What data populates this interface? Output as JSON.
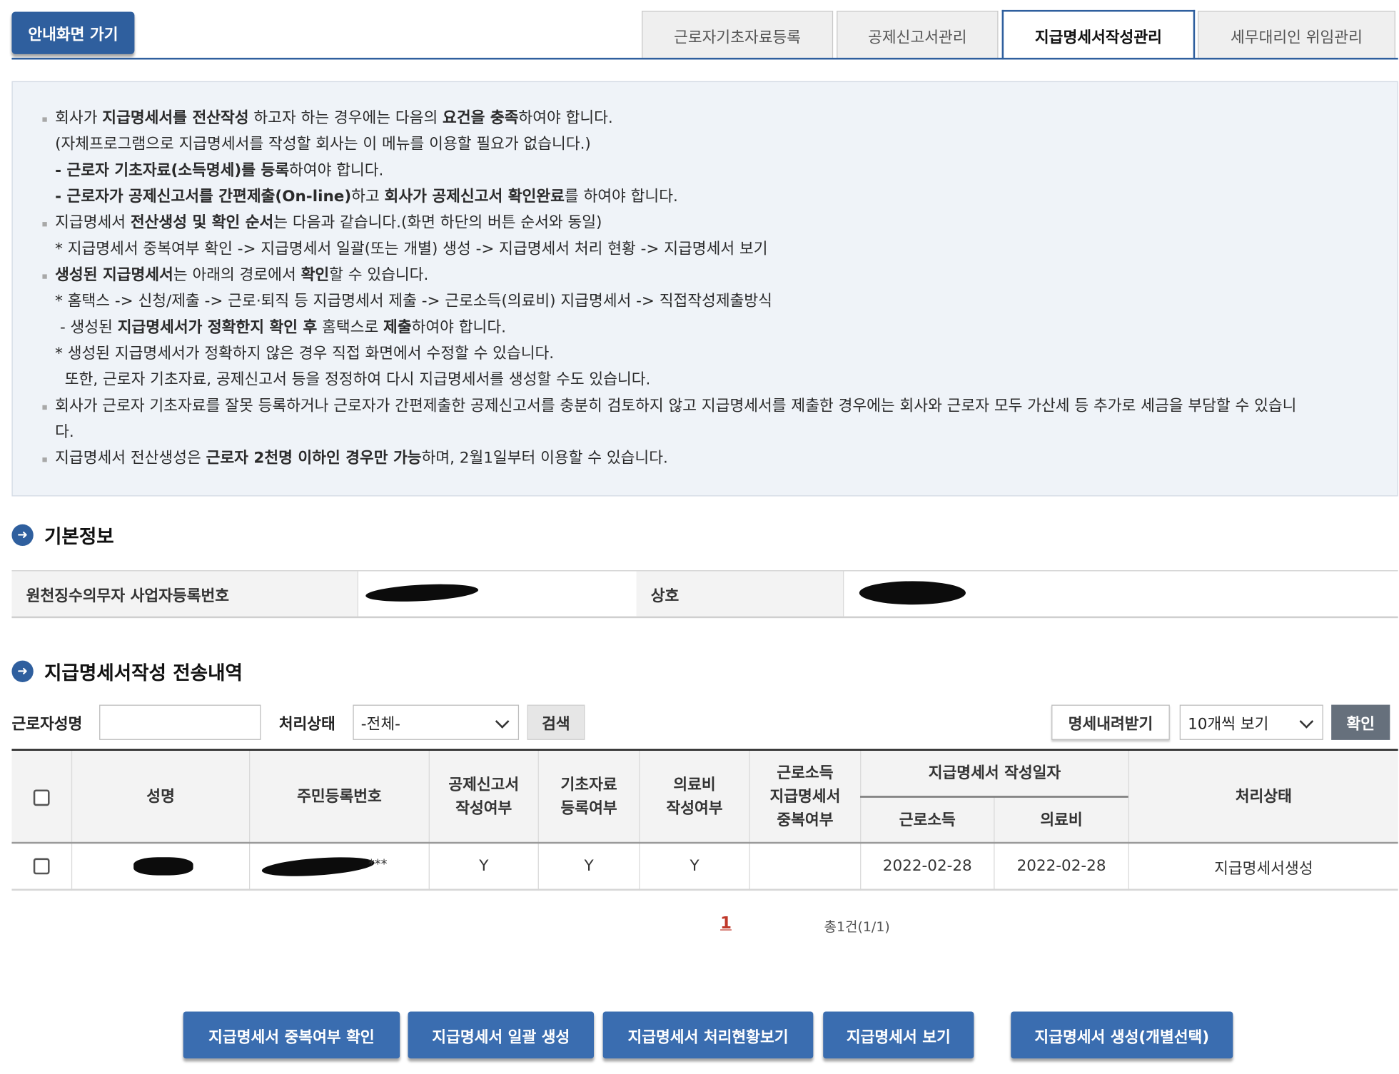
{
  "top": {
    "home_button": "안내화면 가기",
    "tabs": [
      "근로자기초자료등록",
      "공제신고서관리",
      "지급명세서작성관리",
      "세무대리인 위임관리"
    ],
    "active_tab": "지급명세서작성관리"
  },
  "notice": {
    "lines": [
      {
        "bullet": true,
        "segments": [
          [
            "회사가 ",
            false
          ],
          [
            "지급명세서를 전산작성",
            true
          ],
          [
            " 하고자 하는 경우에는 다음의 ",
            false
          ],
          [
            "요건을 충족",
            true
          ],
          [
            "하여야 합니다.",
            false
          ]
        ]
      },
      {
        "bullet": false,
        "segments": [
          [
            "(자체프로그램으로 지급명세서를 작성할 회사는 이 메뉴를 이용할 필요가 없습니다.)",
            false
          ]
        ]
      },
      {
        "bullet": false,
        "segments": [
          [
            "- 근로자 기초자료(소득명세)를 등록",
            true
          ],
          [
            "하여야 합니다.",
            false
          ]
        ]
      },
      {
        "bullet": false,
        "segments": [
          [
            "- 근로자가 공제신고서를 간편제출(On-line)",
            true
          ],
          [
            "하고 ",
            false
          ],
          [
            "회사가 공제신고서 확인완료",
            true
          ],
          [
            "를 하여야 합니다.",
            false
          ]
        ]
      },
      {
        "bullet": true,
        "segments": [
          [
            "지급명세서 ",
            false
          ],
          [
            "전산생성 및 확인 순서",
            true
          ],
          [
            "는 다음과 같습니다.(화면 하단의 버튼 순서와 동일)",
            false
          ]
        ]
      },
      {
        "bullet": false,
        "segments": [
          [
            "* 지급명세서 중복여부 확인 -> 지급명세서 일괄(또는 개별) 생성 -> 지급명세서 처리 현황 -> 지급명세서 보기",
            false
          ]
        ]
      },
      {
        "bullet": true,
        "segments": [
          [
            "생성된 지급명세서",
            true
          ],
          [
            "는 아래의 경로에서 ",
            false
          ],
          [
            "확인",
            true
          ],
          [
            "할 수 있습니다.",
            false
          ]
        ]
      },
      {
        "bullet": false,
        "segments": [
          [
            "* 홈택스 -> 신청/제출 -> 근로·퇴직 등 지급명세서 제출 -> 근로소득(의료비) 지급명세서 -> 직접작성제출방식",
            false
          ]
        ]
      },
      {
        "bullet": false,
        "segments": [
          [
            " - 생성된 ",
            false
          ],
          [
            "지급명세서가 정확한지 확인 후",
            true
          ],
          [
            " 홈택스로 ",
            false
          ],
          [
            "제출",
            true
          ],
          [
            "하여야 합니다.",
            false
          ]
        ]
      },
      {
        "bullet": false,
        "segments": [
          [
            "* 생성된 지급명세서가 정확하지 않은 경우 직접 화면에서 수정할 수 있습니다.",
            false
          ]
        ]
      },
      {
        "bullet": false,
        "segments": [
          [
            "  또한, 근로자 기초자료, 공제신고서 등을 정정하여 다시 지급명세서를 생성할 수도 있습니다.",
            false
          ]
        ]
      },
      {
        "bullet": true,
        "segments": [
          [
            "회사가 근로자 기초자료를 잘못 등록하거나 근로자가 간편제출한 공제신고서를 충분히 검토하지 않고 지급명세서를 제출한 경우에는 회사와 근로자 모두 가산세 등 추가로 세금을 부담할 수 있습니",
            false
          ]
        ]
      },
      {
        "bullet": false,
        "segments": [
          [
            "다.",
            false
          ]
        ]
      },
      {
        "bullet": true,
        "segments": [
          [
            "지급명세서 전산생성은 ",
            false
          ],
          [
            "근로자 2천명 이하인 경우만 가능",
            true
          ],
          [
            "하며, 2월1일부터 이용할 수 있습니다.",
            false
          ]
        ]
      }
    ]
  },
  "basic_info": {
    "title": "기본정보",
    "biz_no_label": "원천징수의무자 사업자등록번호",
    "company_label": "상호"
  },
  "history": {
    "title": "지급명세서작성 전송내역",
    "worker_name_label": "근로자성명",
    "worker_name_value": "",
    "status_label": "처리상태",
    "status_selected": "-전체-",
    "search_button": "검색",
    "download_button": "명세내려받기",
    "page_size_selected": "10개씩 보기",
    "confirm_button": "확인"
  },
  "table": {
    "headers": {
      "name": "성명",
      "rrn": "주민등록번호",
      "deduction": [
        "공제신고서",
        "작성여부"
      ],
      "basic": [
        "기초자료",
        "등록여부"
      ],
      "medical": [
        "의료비",
        "작성여부"
      ],
      "dup": [
        "근로소득",
        "지급명세서",
        "중복여부"
      ],
      "date_group": "지급명세서 작성일자",
      "date_income": "근로소득",
      "date_medical": "의료비",
      "status": "처리상태"
    },
    "rows": [
      {
        "rrn_suffix": "***",
        "deduction": "Y",
        "basic": "Y",
        "medical": "Y",
        "dup": "",
        "date_income": "2022-02-28",
        "date_medical": "2022-02-28",
        "status": "지급명세서생성"
      }
    ]
  },
  "pager": {
    "current_page": "1",
    "total": "총1건(1/1)"
  },
  "actions": [
    "지급명세서 중복여부 확인",
    "지급명세서 일괄 생성",
    "지급명세서 처리현황보기",
    "지급명세서 보기",
    "지급명세서 생성(개별선택)"
  ],
  "colors": {
    "primary": "#2f5f9e",
    "action": "#3a6db0",
    "notice_bg": "#eff3f8",
    "page_active": "#c0392b"
  }
}
